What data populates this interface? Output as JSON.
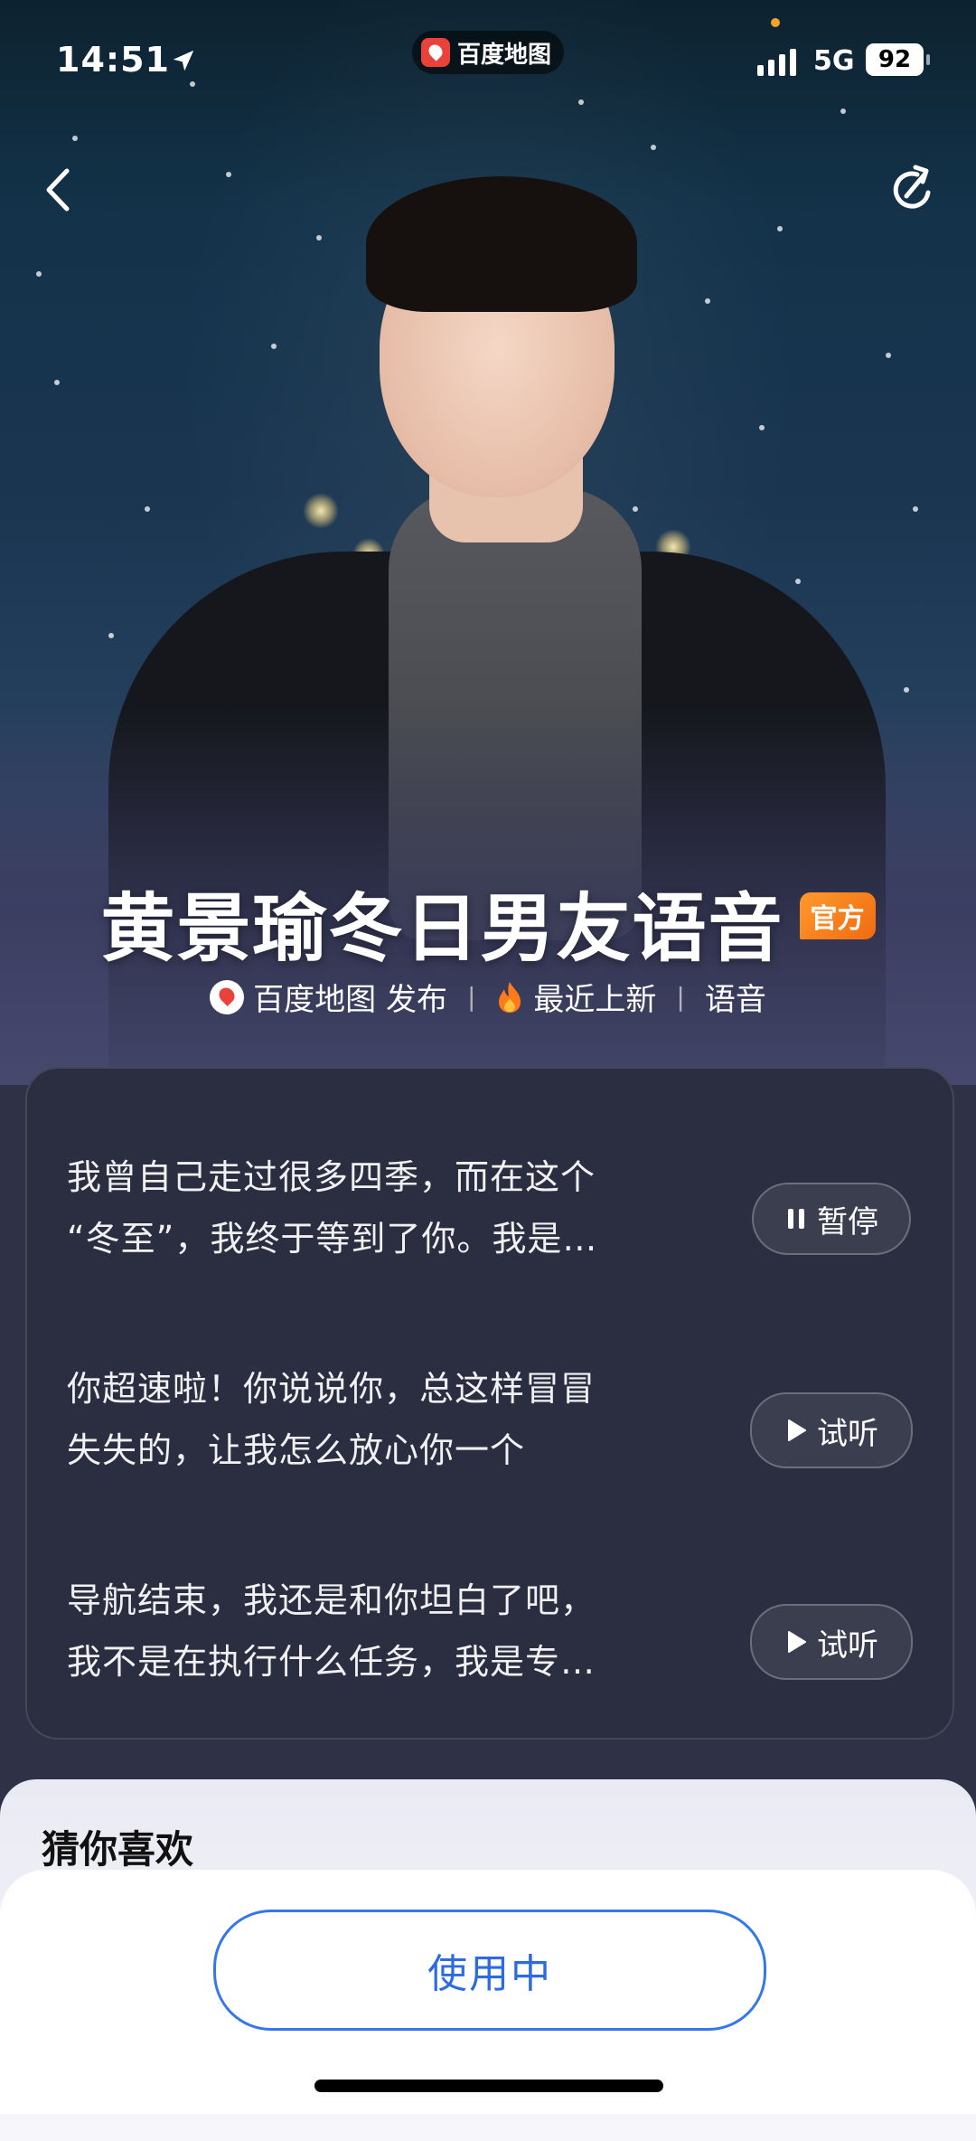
{
  "status_bar": {
    "time": "14:51",
    "app_name": "百度地图",
    "network": "5G",
    "battery": "92"
  },
  "hero": {
    "title": "黄景瑜冬日男友语音",
    "badge": "官方",
    "publisher": "百度地图 发布",
    "separator": "|",
    "tag_recent": "最近上新",
    "tag_type": "语音"
  },
  "voice_samples": [
    {
      "text_line1": "我曾自己走过很多四季，而在这个",
      "text_line2": "“冬至”，我终于等到了你。我是…",
      "button_label": "暂停",
      "state": "playing"
    },
    {
      "text_line1": "你超速啦！你说说你，总这样冒冒",
      "text_line2": "失失的，让我怎么放心你一个",
      "button_label": "试听",
      "state": "idle"
    },
    {
      "text_line1": "导航结束，我还是和你坦白了吧，",
      "text_line2": "我不是在执行什么任务，我是专…",
      "button_label": "试听",
      "state": "idle"
    }
  ],
  "recommend": {
    "title": "猜你喜欢"
  },
  "action": {
    "label": "使用中"
  },
  "colors": {
    "accent_blue": "#2c6be0",
    "badge_orange": "#f06a10",
    "card_bg": "#2b2e40"
  },
  "icons": {
    "back": "chevron-left-icon",
    "share": "share-icon",
    "location": "location-arrow-icon",
    "fire": "fire-icon",
    "pause": "pause-icon",
    "play": "play-icon"
  }
}
